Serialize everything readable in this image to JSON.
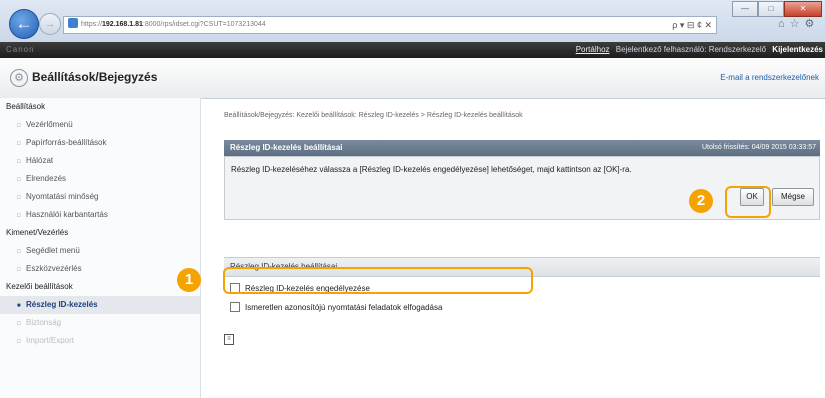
{
  "browser": {
    "url_prefix": "https://",
    "url_host": "192.168.1.81",
    "url_rest": ":8000/rps/idset.cgi?CSUT=1073213044",
    "url_tools": "ρ ▾ ⊟ ¢ ✕",
    "window_buttons": [
      "—",
      "□",
      "✕"
    ]
  },
  "header": {
    "brand": "Canon",
    "portal_link": "Portálhoz",
    "login_user": "Bejelentkező felhasználó: Rendszerkezelő",
    "logout": "Kijelentkezés"
  },
  "titlebar": {
    "title": "Beállítások/Bejegyzés",
    "mail_link": "E-mail a rendszerkezelőnek"
  },
  "sidebar": {
    "group1": "Beállítások",
    "items1": [
      "Vezérlőmenü",
      "Papírforrás-beállítások",
      "Hálózat",
      "Elrendezés",
      "Nyomtatási minőség",
      "Használói karbantartás"
    ],
    "group2": "Kimenet/Vezérlés",
    "items2": [
      "Segédlet menü",
      "Eszközvezérlés"
    ],
    "group3": "Kezelői beállítások",
    "items3": [
      "Részleg ID-kezelés",
      "Biztonság",
      "Import/Export"
    ]
  },
  "main": {
    "breadcrumb": "Beállítások/Bejegyzés: Kezelői beállítások: Részleg ID-kezelés > Részleg ID-kezelés beállítások",
    "panel_title": "Részleg ID-kezelés beállításai",
    "last_update": "Utolsó frissítés: 04/09 2015 03:33:57",
    "instruction": "Részleg ID-kezeléséhez válassza a [Részleg ID-kezelés engedélyezése] lehetőséget, majd kattintson az [OK]-ra.",
    "ok_button": "OK",
    "cancel_button": "Mégse",
    "section_title": "Részleg ID-kezelés beállításai",
    "checkbox_enable": "Részleg ID-kezelés engedélyezése",
    "checkbox_unknown_ids": "Ismeretlen azonosítójú nyomtatási feladatok elfogadása",
    "callout_1": "1",
    "callout_2": "2"
  },
  "colors": {
    "accent": "#f5a300",
    "panel_header": "#6b7b8f",
    "topbar": "#2a2a2a"
  }
}
